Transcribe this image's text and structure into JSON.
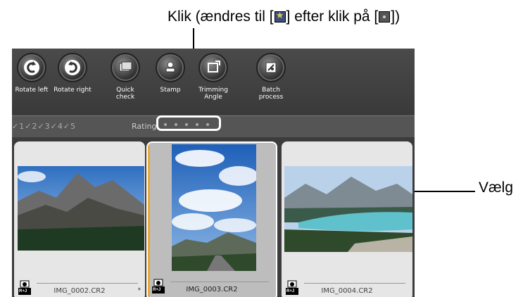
{
  "annotations": {
    "top_before": "Klik (ændres til [",
    "top_middle": "] efter klik på [",
    "top_after": "])",
    "right": "Vælg"
  },
  "toolbar": {
    "items": [
      {
        "label": "Rotate left",
        "icon": "rotate-left-icon"
      },
      {
        "label": "Rotate right",
        "icon": "rotate-right-icon"
      },
      {
        "label": "Quick check",
        "icon": "quick-check-icon"
      },
      {
        "label": "Stamp",
        "icon": "stamp-icon"
      },
      {
        "label": "Trimming Angle",
        "icon": "trimming-angle-icon"
      },
      {
        "label": "Batch process",
        "icon": "batch-process-icon"
      }
    ]
  },
  "rating": {
    "checks": [
      "1",
      "2",
      "3",
      "4",
      "5"
    ],
    "label": "Rating"
  },
  "images": [
    {
      "filename": "IMG_0002.CR2",
      "badge": "R+J",
      "flag": "*",
      "selected": false
    },
    {
      "filename": "IMG_0003.CR2",
      "badge": "R+J",
      "flag": "",
      "selected": true
    },
    {
      "filename": "IMG_0004.CR2",
      "badge": "R+J",
      "flag": "",
      "selected": false
    }
  ],
  "colors": {
    "selection_accent": "#e9a93a",
    "highlight_outline": "#ffffff"
  }
}
